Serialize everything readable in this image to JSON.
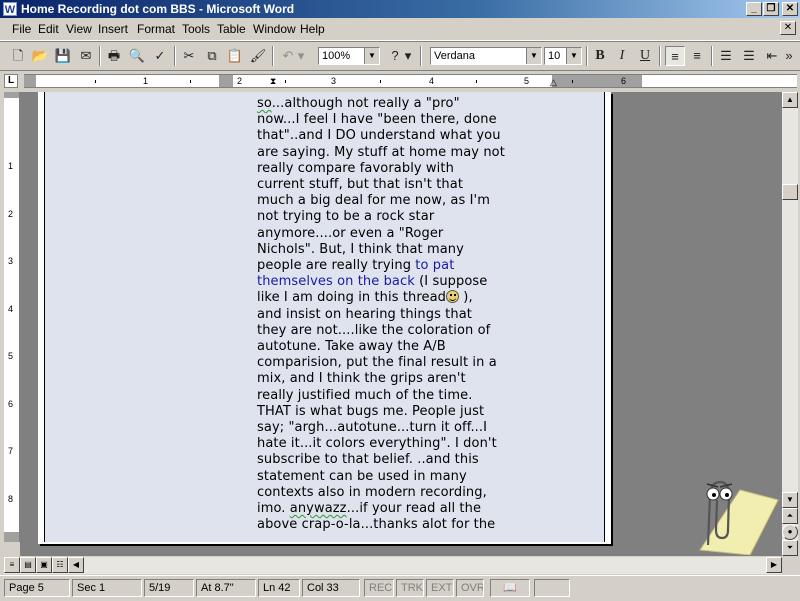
{
  "window": {
    "title": "Home Recording dot com BBS - Microsoft Word",
    "controls": [
      "_",
      "❐",
      "✕"
    ]
  },
  "menu": {
    "items": [
      "File",
      "Edit",
      "View",
      "Insert",
      "Format",
      "Tools",
      "Table",
      "Window",
      "Help"
    ],
    "close_label": "✕"
  },
  "toolbar": {
    "zoom": "100%",
    "font": "Verdana",
    "size": "10",
    "bold": "B",
    "italic": "I",
    "underline": "U"
  },
  "ruler": {
    "tab_glyph": "L",
    "numbers": [
      "1",
      "2",
      "3",
      "4",
      "5",
      "6"
    ],
    "vnumbers": [
      "1",
      "2",
      "3",
      "4",
      "5",
      "6",
      "7",
      "8"
    ]
  },
  "document": {
    "lines": [
      "so...although not really a \"pro\"",
      "now...I feel I have \"been there, done",
      "that\"..and I DO understand what you",
      "are saying. My stuff at home may not",
      "really compare favorably with",
      "current stuff, but that isn't that",
      "much a big deal for me now, as I'm",
      "not trying to be a rock star",
      "anymore....or even a \"Roger",
      "Nichols\". But, I think that many",
      "people are really trying ",
      "themselves on the back",
      "like I am doing in this thread",
      "and insist on hearing things that",
      "they are not....like the coloration of",
      "autotune. Take away the A/B",
      "comparision, put the final result in a",
      "mix, and I think the grips aren't",
      "really justified much of the time.",
      "THAT is what bugs me. People just",
      "say; \"argh...autotune...turn it off...I",
      "hate it...it colors everything\". I don't",
      "subscribe to that belief. ..and this",
      "statement can be used in many",
      "contexts also in modern recording,",
      "imo. ",
      "...if your read all the",
      "above crap-o-la...thanks alot for the"
    ],
    "blue_text_1": "to pat",
    "after_blue": " (I suppose",
    "after_smiley": " ),",
    "squiggle_word": "anywazz",
    "squiggle_so": "so",
    "squiggle_and": "..and"
  },
  "status": {
    "page": "Page 5",
    "sec": "Sec 1",
    "pages": "5/19",
    "at": "At 8.7\"",
    "ln": "Ln 42",
    "col": "Col 33",
    "rec": "REC",
    "trk": "TRK",
    "ext": "EXT",
    "ovr": "OVR"
  }
}
